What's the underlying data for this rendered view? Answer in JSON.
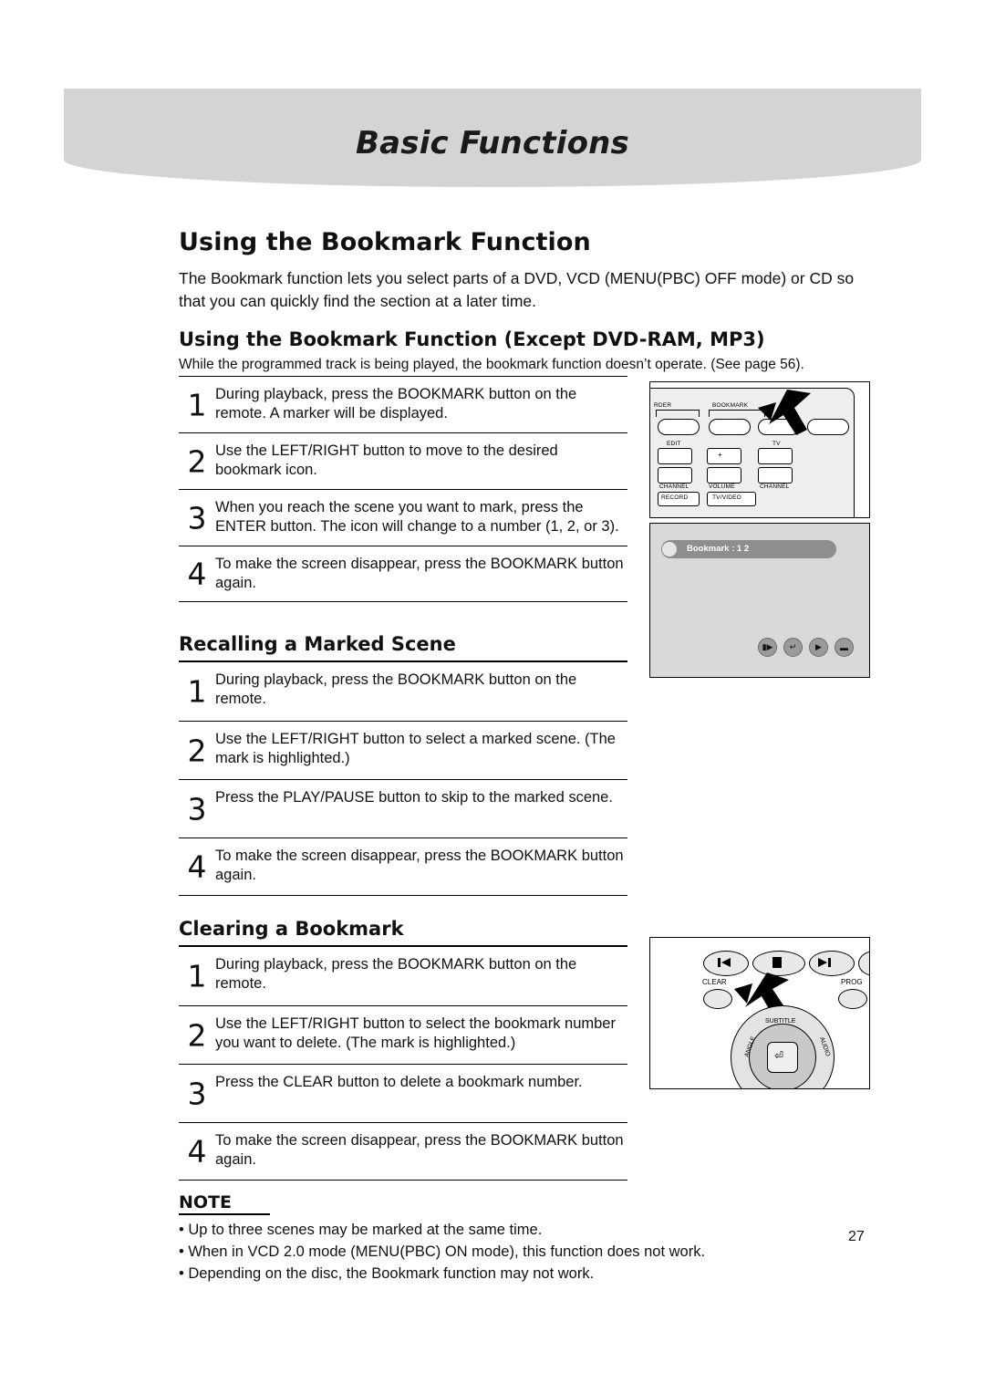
{
  "header": {
    "title": "Basic Functions"
  },
  "page_number": "27",
  "section": {
    "title": "Using the Bookmark Function",
    "intro": "The Bookmark function lets you select parts of a DVD, VCD (MENU(PBC) OFF mode) or CD so that you can quickly find the section at a later time."
  },
  "subsections": [
    {
      "heading": "Using the Bookmark Function (Except DVD-RAM, MP3)",
      "note": "While the programmed track is being played, the bookmark function doesn’t operate. (See page 56).",
      "steps": [
        {
          "num": "1",
          "text": "During playback, press the BOOKMARK button on the remote. A marker will be displayed."
        },
        {
          "num": "2",
          "text": "Use the LEFT/RIGHT button to move to the desired bookmark icon."
        },
        {
          "num": "3",
          "text": "When you reach the scene you want to mark, press the ENTER button. The icon will change to a number (1, 2, or 3)."
        },
        {
          "num": "4",
          "text": "To make the screen disappear, press the BOOKMARK button again."
        }
      ]
    },
    {
      "heading": "Recalling a Marked Scene",
      "steps": [
        {
          "num": "1",
          "text": "During  playback, press the BOOKMARK button on the remote."
        },
        {
          "num": "2",
          "text": "Use the LEFT/RIGHT button to select a marked scene. (The mark is highlighted.)"
        },
        {
          "num": "3",
          "text": "Press the PLAY/PAUSE button to skip to the marked scene."
        },
        {
          "num": "4",
          "text": "To make the screen disappear, press the BOOKMARK button again."
        }
      ]
    },
    {
      "heading": "Clearing a Bookmark",
      "steps": [
        {
          "num": "1",
          "text": "During playback, press the BOOKMARK button on the remote."
        },
        {
          "num": "2",
          "text": "Use the LEFT/RIGHT button to select the bookmark number you want to delete. (The mark is highlighted.)"
        },
        {
          "num": "3",
          "text": "Press the CLEAR button to delete a bookmark number."
        },
        {
          "num": "4",
          "text": "To make the screen disappear, press the BOOKMARK button again."
        }
      ]
    }
  ],
  "note": {
    "title": "NOTE",
    "items": [
      "• Up to three scenes may be marked at the same time.",
      "• When in VCD 2.0 mode (MENU(PBC) ON mode), this function does not work.",
      "• Depending on the disc, the Bookmark function may not work."
    ]
  },
  "illustrations": {
    "remote_top": {
      "labels": [
        "RDER",
        "BOOKMARK",
        "EDIT",
        "TV",
        "CHANNEL",
        "VOLUME",
        "CHANNEL",
        "RECORD",
        "TV/VIDEO"
      ],
      "plus": "+",
      "minus": "–"
    },
    "osd_screen": {
      "bookmark_label": "Bookmark : 1 2",
      "icons": [
        "play-pause-icon",
        "enter-icon",
        "play-icon",
        "clear-icon"
      ]
    },
    "remote_bottom": {
      "labels": [
        "CLEAR",
        "PROG",
        "ANGLE",
        "SUBTITLE",
        "AUDIO"
      ]
    }
  }
}
